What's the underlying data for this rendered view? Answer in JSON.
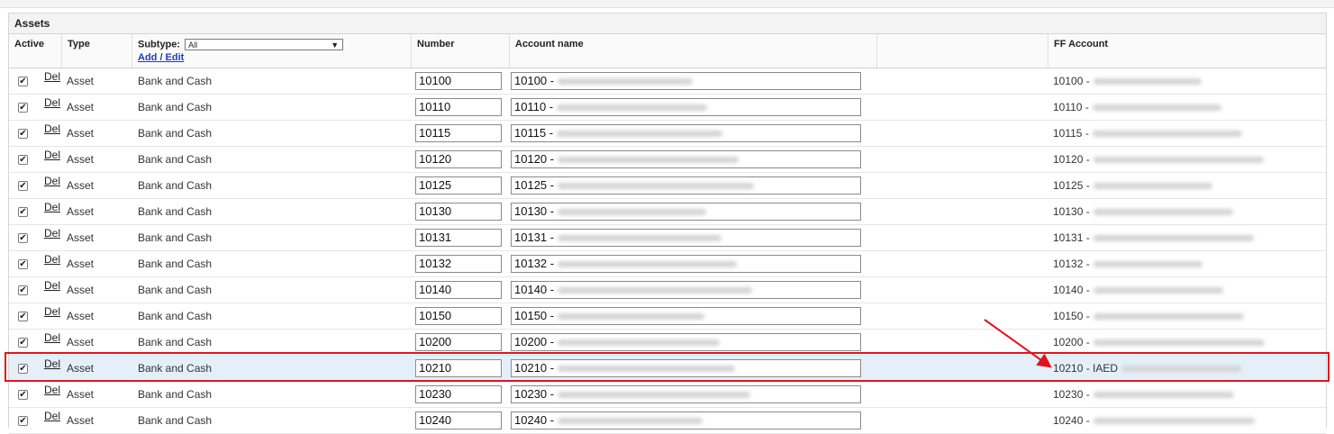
{
  "panel": {
    "title": "Assets"
  },
  "headers": {
    "active": "Active",
    "type": "Type",
    "subtype_label": "Subtype:",
    "subtype_value": "All",
    "add_edit": "Add / Edit",
    "number": "Number",
    "account_name": "Account name",
    "ff_account": "FF Account"
  },
  "del_label": "Del",
  "rows": [
    {
      "type": "Asset",
      "subtype": "Bank and Cash",
      "number": "10100",
      "account": "10100 -",
      "ff": "10100 -",
      "checked": true
    },
    {
      "type": "Asset",
      "subtype": "Bank and Cash",
      "number": "10110",
      "account": "10110 -",
      "ff": "10110 -",
      "checked": true
    },
    {
      "type": "Asset",
      "subtype": "Bank and Cash",
      "number": "10115",
      "account": "10115 -",
      "ff": "10115 -",
      "checked": true
    },
    {
      "type": "Asset",
      "subtype": "Bank and Cash",
      "number": "10120",
      "account": "10120 -",
      "ff": "10120 -",
      "checked": true
    },
    {
      "type": "Asset",
      "subtype": "Bank and Cash",
      "number": "10125",
      "account": "10125 -",
      "ff": "10125 -",
      "checked": true
    },
    {
      "type": "Asset",
      "subtype": "Bank and Cash",
      "number": "10130",
      "account": "10130 -",
      "ff": "10130 -",
      "checked": true
    },
    {
      "type": "Asset",
      "subtype": "Bank and Cash",
      "number": "10131",
      "account": "10131 -",
      "ff": "10131 -",
      "checked": true
    },
    {
      "type": "Asset",
      "subtype": "Bank and Cash",
      "number": "10132",
      "account": "10132 -",
      "ff": "10132 -",
      "checked": true
    },
    {
      "type": "Asset",
      "subtype": "Bank and Cash",
      "number": "10140",
      "account": "10140 -",
      "ff": "10140 -",
      "checked": true
    },
    {
      "type": "Asset",
      "subtype": "Bank and Cash",
      "number": "10150",
      "account": "10150 -",
      "ff": "10150 -",
      "checked": true
    },
    {
      "type": "Asset",
      "subtype": "Bank and Cash",
      "number": "10200",
      "account": "10200 -",
      "ff": "10200 -",
      "checked": true
    },
    {
      "type": "Asset",
      "subtype": "Bank and Cash",
      "number": "10210",
      "account": "10210 -",
      "ff": "10210 - IAED",
      "checked": true,
      "selected": true
    },
    {
      "type": "Asset",
      "subtype": "Bank and Cash",
      "number": "10230",
      "account": "10230 -",
      "ff": "10230 -",
      "checked": true
    },
    {
      "type": "Asset",
      "subtype": "Bank and Cash",
      "number": "10240",
      "account": "10240 -",
      "ff": "10240 -",
      "checked": true
    }
  ],
  "colors": {
    "highlight": "#e0141b",
    "selected_row": "#e4effa",
    "link": "#1a3bbf"
  },
  "icons": {
    "checkbox": "checkmark-icon",
    "dropdown": "chevron-down-icon",
    "annotation": "arrow-annotation"
  }
}
